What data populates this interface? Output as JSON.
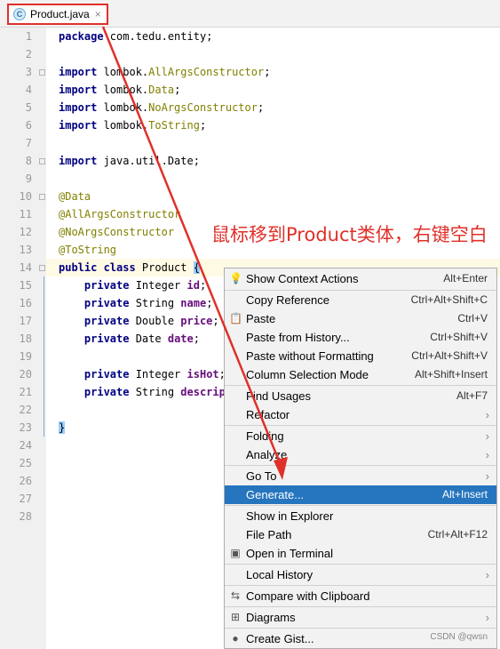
{
  "tab": {
    "icon": "class-icon",
    "icon_letter": "C",
    "name": "Product.java",
    "close": "×"
  },
  "line_numbers": [
    "1",
    "2",
    "3",
    "4",
    "5",
    "6",
    "7",
    "8",
    "9",
    "10",
    "11",
    "12",
    "13",
    "14",
    "15",
    "16",
    "17",
    "18",
    "19",
    "20",
    "21",
    "22",
    "23",
    "24",
    "25",
    "26",
    "27",
    "28"
  ],
  "code": {
    "l1_kw": "package",
    "l1_rest": " com.tedu.entity;",
    "l3_kw": "import",
    "l3_pre": " lombok.",
    "l3_cls": "AllArgsConstructor",
    "l3_end": ";",
    "l4_kw": "import",
    "l4_pre": " lombok.",
    "l4_cls": "Data",
    "l4_end": ";",
    "l5_kw": "import",
    "l5_pre": " lombok.",
    "l5_cls": "NoArgsConstructor",
    "l5_end": ";",
    "l6_kw": "import",
    "l6_pre": " lombok.",
    "l6_cls": "ToString",
    "l6_end": ";",
    "l8_kw": "import",
    "l8_rest": " java.util.Date;",
    "l10": "@Data",
    "l11": "@AllArgsConstructor",
    "l12": "@NoArgsConstructor",
    "l13": "@ToString",
    "l14_kw": "public class",
    "l14_rest": " Product ",
    "l14_brace": "{",
    "l15_kw": "    private",
    "l15_rest": " Integer ",
    "l15_f": "id",
    "l15_end": ";",
    "l16_kw": "    private",
    "l16_rest": " String ",
    "l16_f": "name",
    "l16_end": ";",
    "l17_kw": "    private",
    "l17_rest": " Double ",
    "l17_f": "price",
    "l17_end": ";",
    "l18_kw": "    private",
    "l18_rest": " Date ",
    "l18_f": "date",
    "l18_end": ";",
    "l20_kw": "    private",
    "l20_rest": " Integer ",
    "l20_f": "isHot",
    "l20_end": ";",
    "l21_kw": "    private",
    "l21_rest": " String ",
    "l21_f": "descript",
    "l23": "}"
  },
  "annotation": {
    "text": "鼠标移到Product类体，右键空白",
    "color": "#e0302a"
  },
  "menu": {
    "items": [
      {
        "label": "Show Context Actions",
        "shortcut": "Alt+Enter",
        "icon": "bulb-icon"
      },
      {
        "label": "Copy Reference",
        "shortcut": "Ctrl+Alt+Shift+C"
      },
      {
        "label": "Paste",
        "shortcut": "Ctrl+V",
        "icon": "clipboard-icon"
      },
      {
        "label": "Paste from History...",
        "shortcut": "Ctrl+Shift+V"
      },
      {
        "label": "Paste without Formatting",
        "shortcut": "Ctrl+Alt+Shift+V"
      },
      {
        "label": "Column Selection Mode",
        "shortcut": "Alt+Shift+Insert"
      },
      {
        "label": "Find Usages",
        "shortcut": "Alt+F7"
      },
      {
        "label": "Refactor",
        "submenu": "›"
      },
      {
        "label": "Folding",
        "submenu": "›"
      },
      {
        "label": "Analyze",
        "submenu": "›"
      },
      {
        "label": "Go To",
        "submenu": "›"
      },
      {
        "label": "Generate...",
        "shortcut": "Alt+Insert",
        "selected": true
      },
      {
        "label": "Show in Explorer"
      },
      {
        "label": "File Path",
        "shortcut": "Ctrl+Alt+F12"
      },
      {
        "label": "Open in Terminal",
        "icon": "terminal-icon"
      },
      {
        "label": "Local History",
        "submenu": "›"
      },
      {
        "label": "Compare with Clipboard",
        "icon": "compare-icon"
      },
      {
        "label": "Diagrams",
        "submenu": "›",
        "icon": "diagram-icon"
      },
      {
        "label": "Create Gist...",
        "icon": "github-icon"
      }
    ],
    "selected_color": "#2675bf"
  },
  "watermark": "CSDN @qwsn"
}
